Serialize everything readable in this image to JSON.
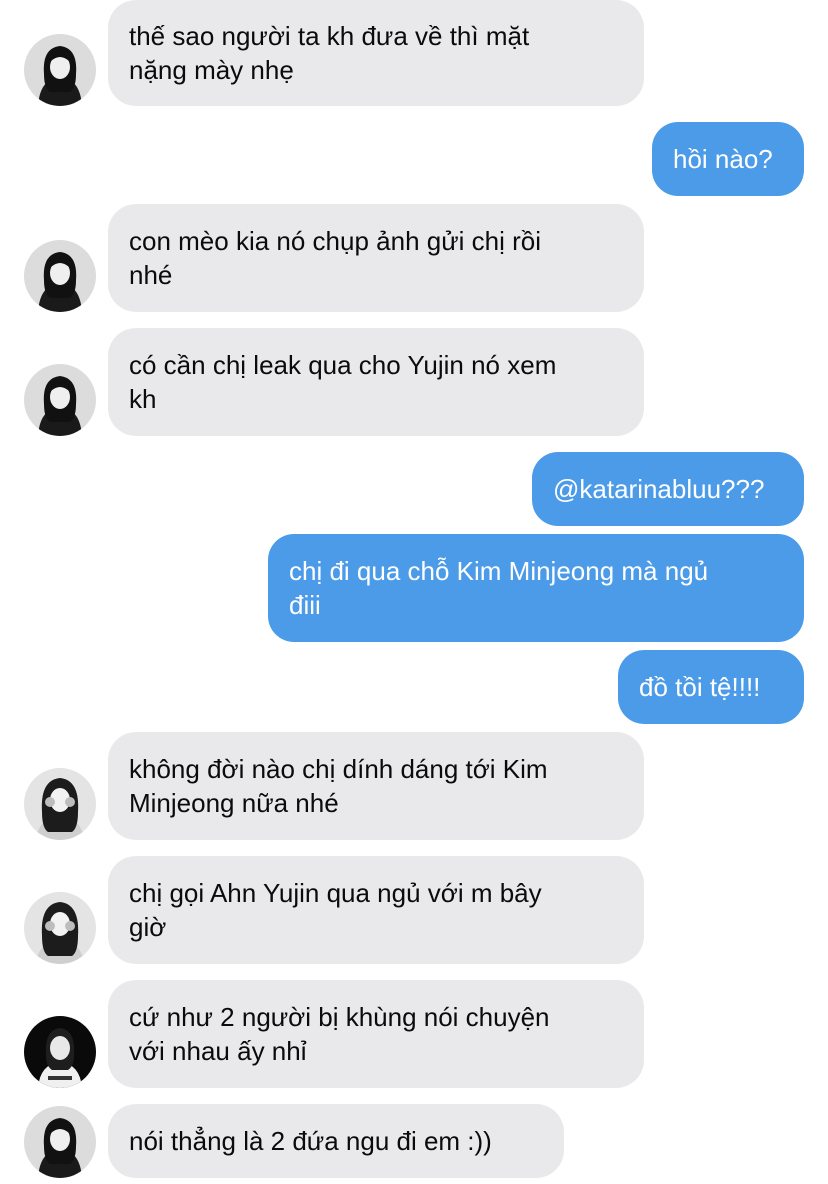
{
  "messages": [
    {
      "side": "in",
      "avatar": "girl-dark-hair",
      "text": "thế sao người ta kh đưa về thì mặt\nnặng mày nhẹ"
    },
    {
      "side": "out",
      "text": "hồi nào?"
    },
    {
      "side": "in",
      "avatar": "girl-dark-hair",
      "text": "con mèo kia nó chụp ảnh gửi chị rồi\nnhé"
    },
    {
      "side": "in",
      "avatar": "girl-dark-hair",
      "text": "có cần chị leak qua cho Yujin nó xem\nkh"
    },
    {
      "side": "out",
      "text": "@katarinabluu???"
    },
    {
      "side": "out",
      "text": "chị đi qua chỗ Kim Minjeong mà ngủ\nđiii"
    },
    {
      "side": "out",
      "text": "đồ tồi tệ!!!!"
    },
    {
      "side": "in",
      "avatar": "girl-hands-face",
      "text": "không đời nào chị dính dáng tới Kim\nMinjeong nữa nhé"
    },
    {
      "side": "in",
      "avatar": "girl-hands-face",
      "text": "chị gọi Ahn Yujin qua ngủ với m bây\ngiờ"
    },
    {
      "side": "in",
      "avatar": "girl-black-background",
      "text": "cứ như 2 người bị khùng nói chuyện\nvới nhau ấy nhỉ"
    },
    {
      "side": "in",
      "avatar": "girl-dark-hair",
      "text": "nói thẳng là 2 đứa ngu đi em :))"
    }
  ],
  "colors": {
    "incoming_bubble": "#e9e9eb",
    "outgoing_bubble": "#4c9be8",
    "incoming_text": "#0b0b0b",
    "outgoing_text": "#ffffff"
  }
}
